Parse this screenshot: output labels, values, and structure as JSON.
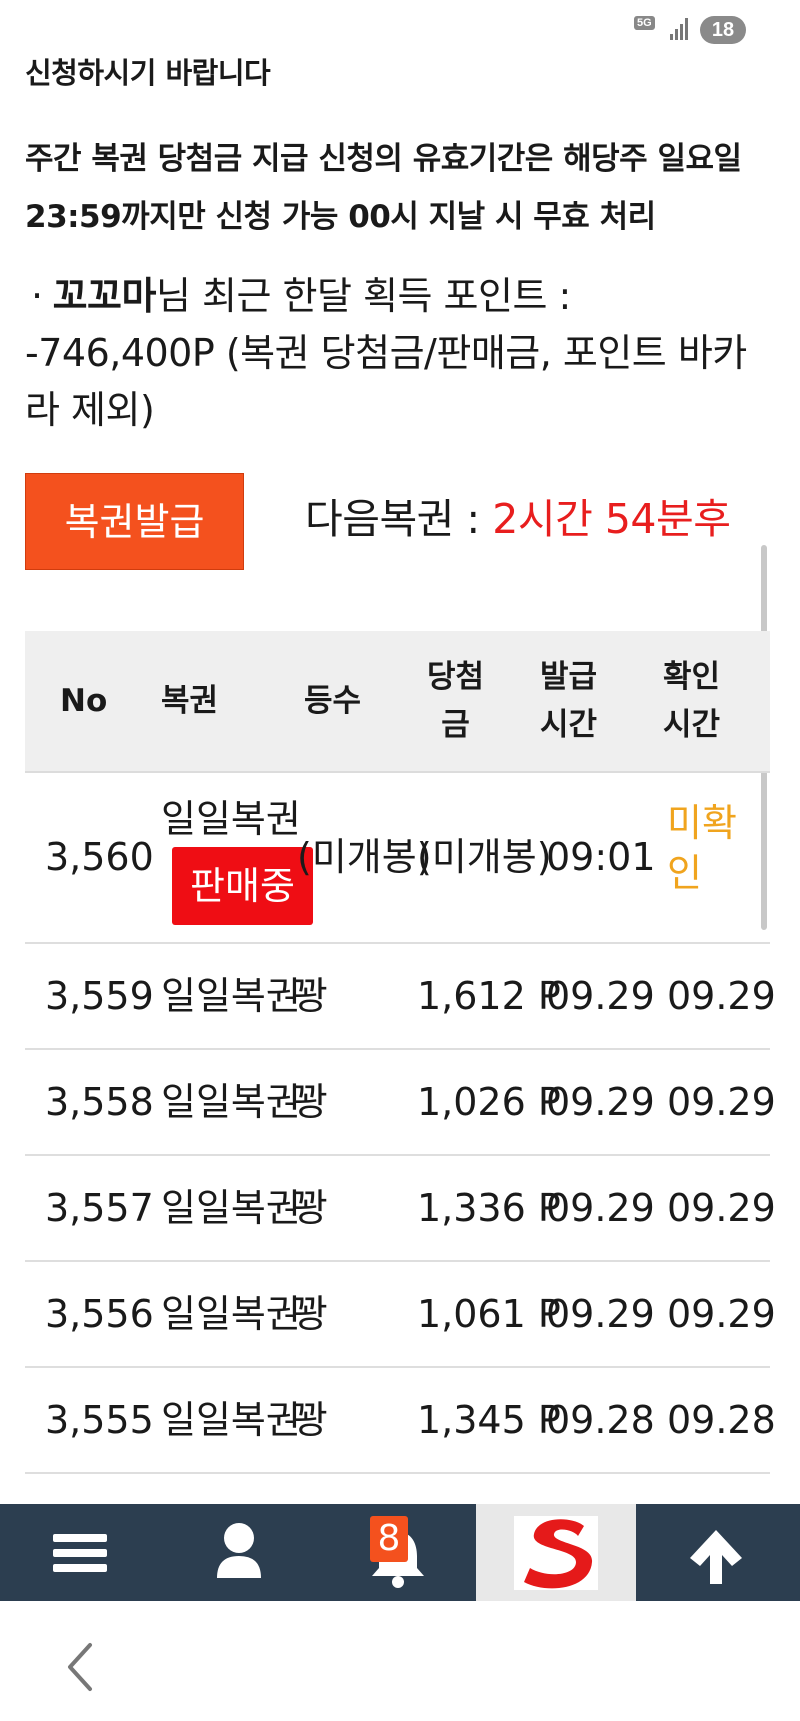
{
  "status_bar": {
    "network": "5G",
    "battery": "18"
  },
  "notice": {
    "line1": "신청하시기 바랍니다",
    "line2": "주간 복권 당첨금 지급 신청의 유효기간은 해당주 일요일 23:59까지만 신청 가능 00시 지날 시 무효 처리"
  },
  "points": {
    "dot": "·",
    "username": "꼬꼬마",
    "text": "님 최근 한달 획득 포인트 : -746,400P (복권 당첨금/판매금, 포인트 바카라 제외)"
  },
  "actions": {
    "issue_label": "복권발급",
    "next_label": "다음복권 : ",
    "next_countdown": "2시간 54분후"
  },
  "table": {
    "headers": {
      "no": "No",
      "lottery": "복권",
      "rank": "등수",
      "prize_1": "당첨",
      "prize_2": "금",
      "issued_1": "발급",
      "issued_2": "시간",
      "confirmed_1": "확인",
      "confirmed_2": "시간"
    },
    "first_row": {
      "no": "3,560",
      "lottery": "일일복권",
      "badge": "판매중",
      "rank": "(미개봉)",
      "prize": "(미개봉)",
      "issued": "09:01",
      "confirmed_1": "미확",
      "confirmed_2": "인"
    },
    "rows": [
      {
        "no": "3,559",
        "lottery": "일일복권",
        "rank": "꽝",
        "prize": "1,612 P",
        "issued": "09.29",
        "confirmed": "09.29"
      },
      {
        "no": "3,558",
        "lottery": "일일복권",
        "rank": "꽝",
        "prize": "1,026 P",
        "issued": "09.29",
        "confirmed": "09.29"
      },
      {
        "no": "3,557",
        "lottery": "일일복권",
        "rank": "꽝",
        "prize": "1,336 P",
        "issued": "09.29",
        "confirmed": "09.29"
      },
      {
        "no": "3,556",
        "lottery": "일일복권",
        "rank": "꽝",
        "prize": "1,061 P",
        "issued": "09.29",
        "confirmed": "09.29"
      },
      {
        "no": "3,555",
        "lottery": "일일복권",
        "rank": "꽝",
        "prize": "1,345 P",
        "issued": "09.28",
        "confirmed": "09.28"
      }
    ]
  },
  "navbar": {
    "items": [
      "menu-icon",
      "user-icon",
      "bell-icon",
      "site-logo-icon",
      "arrow-up-icon"
    ],
    "notification_count": "8"
  },
  "colors": {
    "accent": "#f4511e",
    "countdown": "#e81e1e",
    "badge": "#ef0d14",
    "unconfirmed": "#f0a41e",
    "navbar": "#2c3e50"
  }
}
